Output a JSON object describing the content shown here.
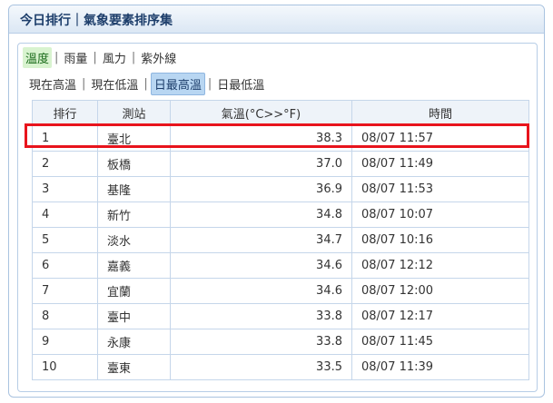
{
  "header": {
    "title": "今日排行｜氣象要素排序集"
  },
  "category_tabs": [
    {
      "label": "溫度",
      "active": true
    },
    {
      "label": "雨量",
      "active": false
    },
    {
      "label": "風力",
      "active": false
    },
    {
      "label": "紫外線",
      "active": false
    }
  ],
  "sub_tabs": [
    {
      "label": "現在高溫",
      "active": false
    },
    {
      "label": "現在低溫",
      "active": false
    },
    {
      "label": "日最高溫",
      "active": true
    },
    {
      "label": "日最低溫",
      "active": false
    }
  ],
  "separator": "|",
  "table": {
    "headers": [
      "排行",
      "測站",
      "氣溫(°C>>°F)",
      "時間"
    ],
    "rows": [
      {
        "rank": "1",
        "station": "臺北",
        "temp": "38.3",
        "time": "08/07 11:57"
      },
      {
        "rank": "2",
        "station": "板橋",
        "temp": "37.0",
        "time": "08/07 11:49"
      },
      {
        "rank": "3",
        "station": "基隆",
        "temp": "36.9",
        "time": "08/07 11:53"
      },
      {
        "rank": "4",
        "station": "新竹",
        "temp": "34.8",
        "time": "08/07 10:07"
      },
      {
        "rank": "5",
        "station": "淡水",
        "temp": "34.7",
        "time": "08/07 10:16"
      },
      {
        "rank": "6",
        "station": "嘉義",
        "temp": "34.6",
        "time": "08/07 12:12"
      },
      {
        "rank": "7",
        "station": "宜蘭",
        "temp": "34.6",
        "time": "08/07 12:00"
      },
      {
        "rank": "8",
        "station": "臺中",
        "temp": "33.8",
        "time": "08/07 12:17"
      },
      {
        "rank": "9",
        "station": "永康",
        "temp": "33.8",
        "time": "08/07 11:45"
      },
      {
        "rank": "10",
        "station": "臺東",
        "temp": "33.5",
        "time": "08/07 11:39"
      }
    ]
  },
  "colors": {
    "highlight_border": "#e8141c",
    "active_category_bg": "#d8f3cf",
    "active_subtab_bg": "#b8d6f2",
    "title_color": "#1d3e6b"
  }
}
